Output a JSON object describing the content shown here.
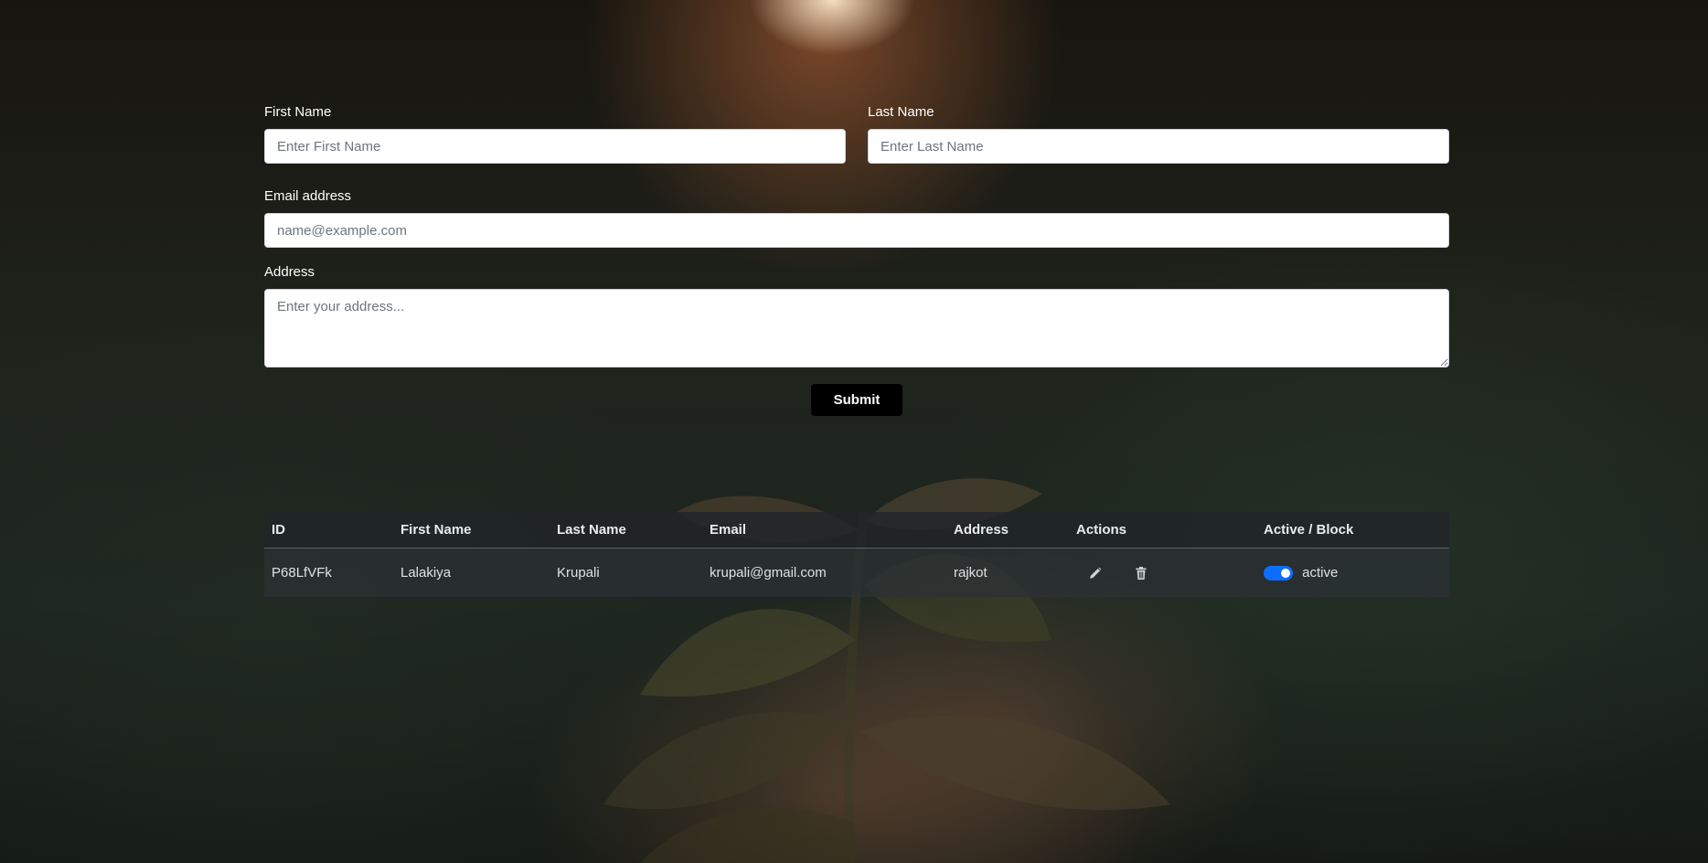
{
  "form": {
    "first_name": {
      "label": "First Name",
      "placeholder": "Enter First Name",
      "value": ""
    },
    "last_name": {
      "label": "Last Name",
      "placeholder": "Enter Last Name",
      "value": ""
    },
    "email": {
      "label": "Email address",
      "placeholder": "name@example.com",
      "value": ""
    },
    "address": {
      "label": "Address",
      "placeholder": "Enter your address...",
      "value": ""
    },
    "submit_label": "Submit"
  },
  "table": {
    "headers": {
      "id": "ID",
      "first_name": "First Name",
      "last_name": "Last Name",
      "email": "Email",
      "address": "Address",
      "actions": "Actions",
      "status": "Active / Block"
    },
    "rows": [
      {
        "id": "P68LfVFk",
        "first_name": "Lalakiya",
        "last_name": "Krupali",
        "email": "krupali@gmail.com",
        "address": "rajkot",
        "status": "active",
        "active": true,
        "edit_icon": "pencil-icon",
        "delete_icon": "trash-icon"
      }
    ]
  },
  "colors": {
    "toggle_on": "#0d6efd",
    "submit_bg": "#000000",
    "table_header_bg": "#212529"
  }
}
